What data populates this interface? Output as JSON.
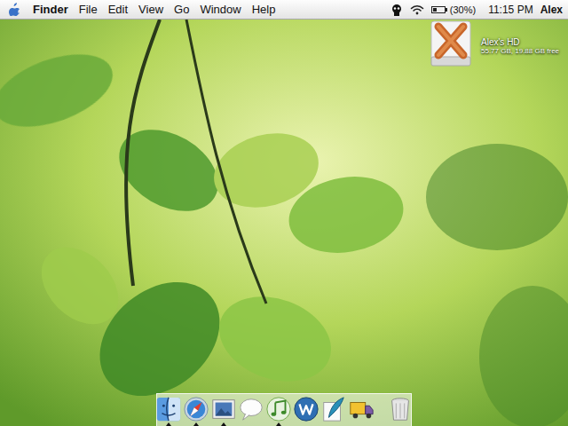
{
  "menu_bar": {
    "app": "Finder",
    "menus": [
      "File",
      "Edit",
      "View",
      "Go",
      "Window",
      "Help"
    ],
    "wifi_on": true,
    "battery": {
      "level": 0.3,
      "reading": "(30%)"
    },
    "clock": "11:15 PM",
    "user": "Alex"
  },
  "desktop_icons": [
    {
      "name": "Alex's HD",
      "info": "55.77 GB, 19.88 GB free"
    }
  ],
  "dock": {
    "items": [
      {
        "kind": "finder",
        "running": true
      },
      {
        "kind": "safari",
        "running": true
      },
      {
        "kind": "iphoto",
        "running": true
      },
      {
        "kind": "ichat",
        "running": false
      },
      {
        "kind": "itunes",
        "running": true
      },
      {
        "kind": "network",
        "running": false
      },
      {
        "kind": "quill",
        "running": false
      },
      {
        "kind": "truck",
        "running": false
      },
      {
        "kind": "trash",
        "running": false
      }
    ]
  }
}
